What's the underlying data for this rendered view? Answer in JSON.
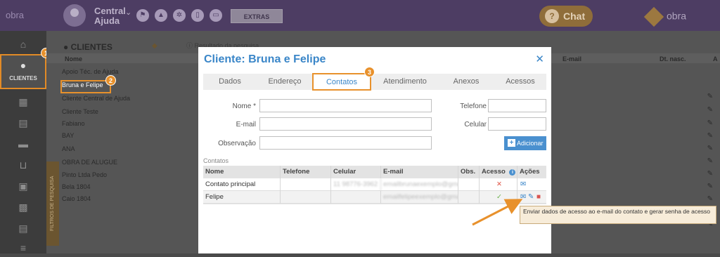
{
  "topbar": {
    "logo": "obra",
    "central_line1": "Central",
    "central_line2": "Ajuda",
    "chevron_icon": "chevron-down-icon",
    "extras_label": "EXTRAS",
    "chat_label": "Chat",
    "right_logo": "obra"
  },
  "sidebar": {
    "active_label": "CLIENTES",
    "badge_1": "1"
  },
  "background": {
    "title": "CLIENTES",
    "search_hint": "Resultado da pesquisa",
    "col_nome": "Nome",
    "col_email": "E-mail",
    "col_dtnasc": "Dt. nasc.",
    "col_acoes": "A",
    "rows": [
      "Apoio Téc. de Ajuda",
      "Bruna e Felipe",
      "Cliente Central de Ajuda",
      "Cliente Teste",
      "Fabiano",
      "BAY",
      "ANA",
      "OBRA DE ALUGUE",
      "Pinto Ltda Pedo",
      "Bela 1804",
      "Caio 1804"
    ],
    "badge_2": "2",
    "vertical_tab": "FILTROS DE PESQUISA"
  },
  "modal": {
    "title": "Cliente: Bruna e Felipe",
    "close_icon": "close-icon",
    "badge_3": "3",
    "tabs": [
      "Dados",
      "Endereço",
      "Contatos",
      "Atendimento",
      "Anexos",
      "Acessos"
    ],
    "form": {
      "nome_label": "Nome *",
      "email_label": "E-mail",
      "obs_label": "Observação",
      "telefone_label": "Telefone",
      "celular_label": "Celular",
      "add_button": "Adicionar"
    },
    "section_label": "Contatos",
    "grid": {
      "headers": [
        "Nome",
        "Telefone",
        "Celular",
        "E-mail",
        "Obs.",
        "Acesso",
        "Ações"
      ],
      "rows": [
        {
          "nome": "Contato principal",
          "telefone": "",
          "celular": "11 98776-3962",
          "email": "emailbrunaexemplo@gma...",
          "email_suffix": "@gma...",
          "obs": "",
          "acesso": "x-icon"
        },
        {
          "nome": "Felipe",
          "telefone": "",
          "celular": "",
          "email": "emailfelipeexemplo@gma...",
          "email_suffix": "@gma...",
          "obs": "",
          "acesso": "check-icon"
        }
      ]
    },
    "tooltip": "Enviar dados de acesso ao e-mail do contato e gerar senha de acesso"
  },
  "colors": {
    "accent": "#3a86c8",
    "highlight": "#e8912c",
    "topbar": "#4d3d63"
  }
}
